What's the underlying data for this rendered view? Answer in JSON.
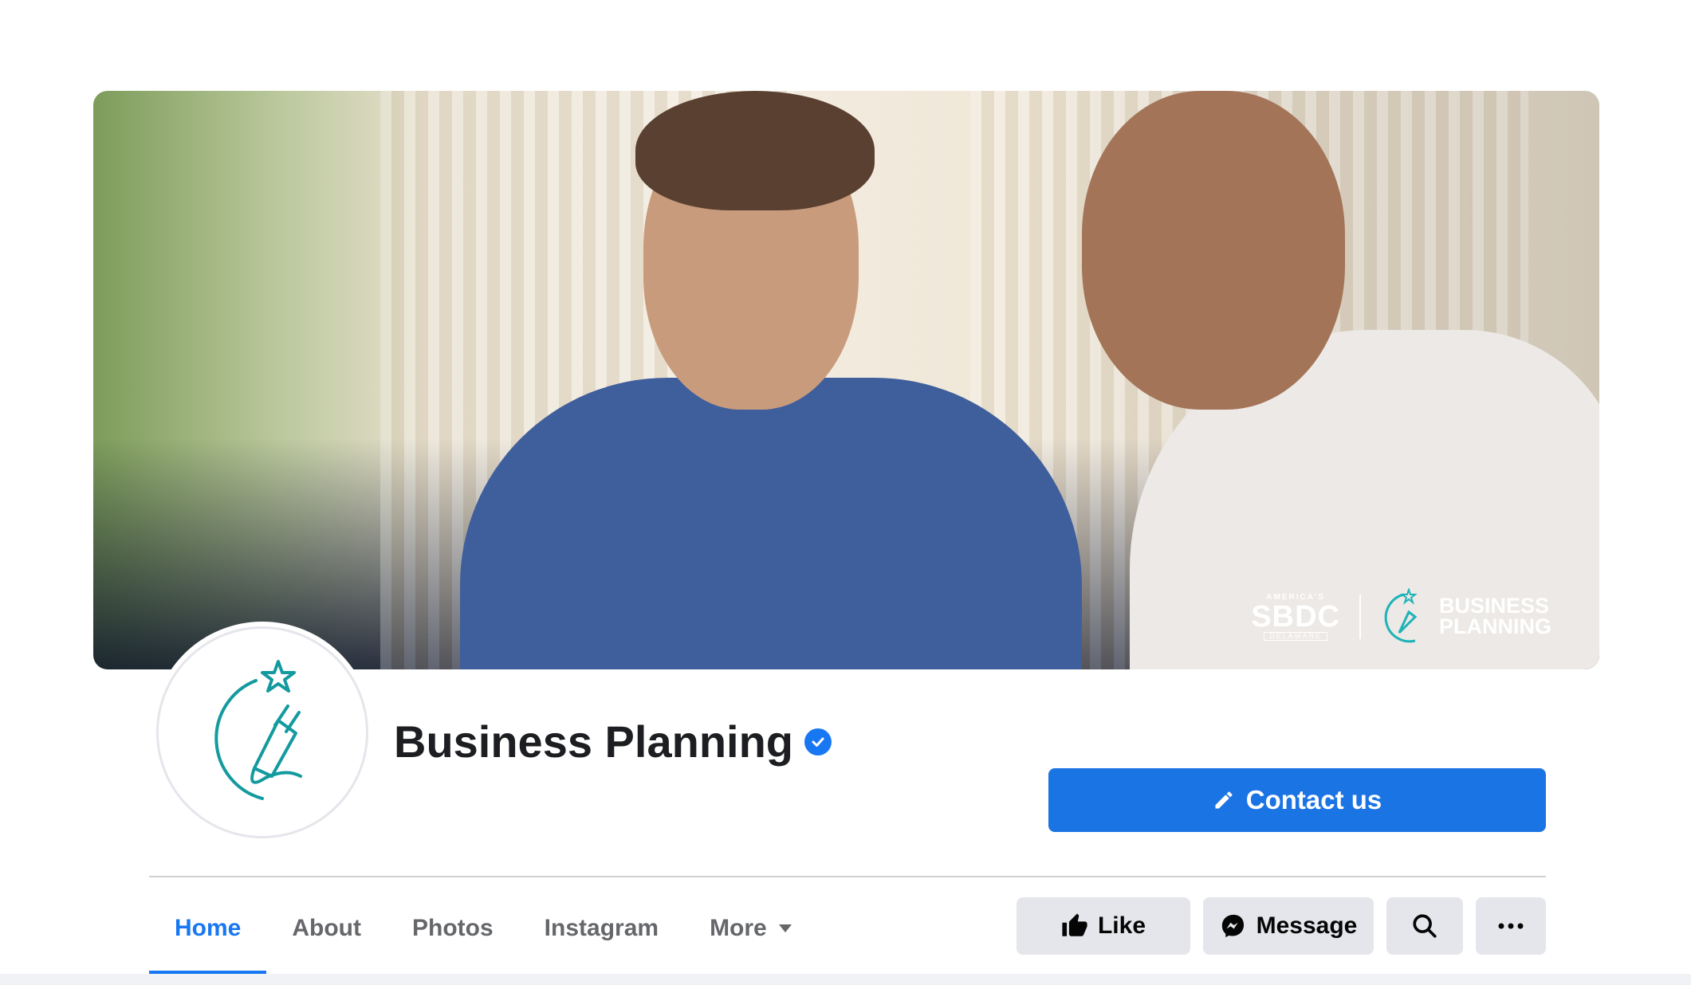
{
  "page": {
    "name": "Business Planning",
    "verified": true
  },
  "cover": {
    "logo_small": "AMERICA'S",
    "logo_main": "SBDC",
    "logo_state": "DELAWARE",
    "wordmark_line1": "BUSINESS",
    "wordmark_line2": "PLANNING"
  },
  "buttons": {
    "contact": "Contact us",
    "like": "Like",
    "message": "Message"
  },
  "tabs": [
    {
      "label": "Home",
      "active": true
    },
    {
      "label": "About",
      "active": false
    },
    {
      "label": "Photos",
      "active": false
    },
    {
      "label": "Instagram",
      "active": false
    },
    {
      "label": "More",
      "active": false
    }
  ],
  "icons": {
    "verified": "verified-check-icon",
    "contact": "pencil-icon",
    "like": "thumbs-up-icon",
    "message": "messenger-icon",
    "search": "search-icon",
    "more": "ellipsis-icon",
    "tab_more": "caret-down-icon"
  },
  "colors": {
    "accent": "#1877f2",
    "brand_teal": "#139a9f",
    "button_gray": "#e4e6eb"
  }
}
